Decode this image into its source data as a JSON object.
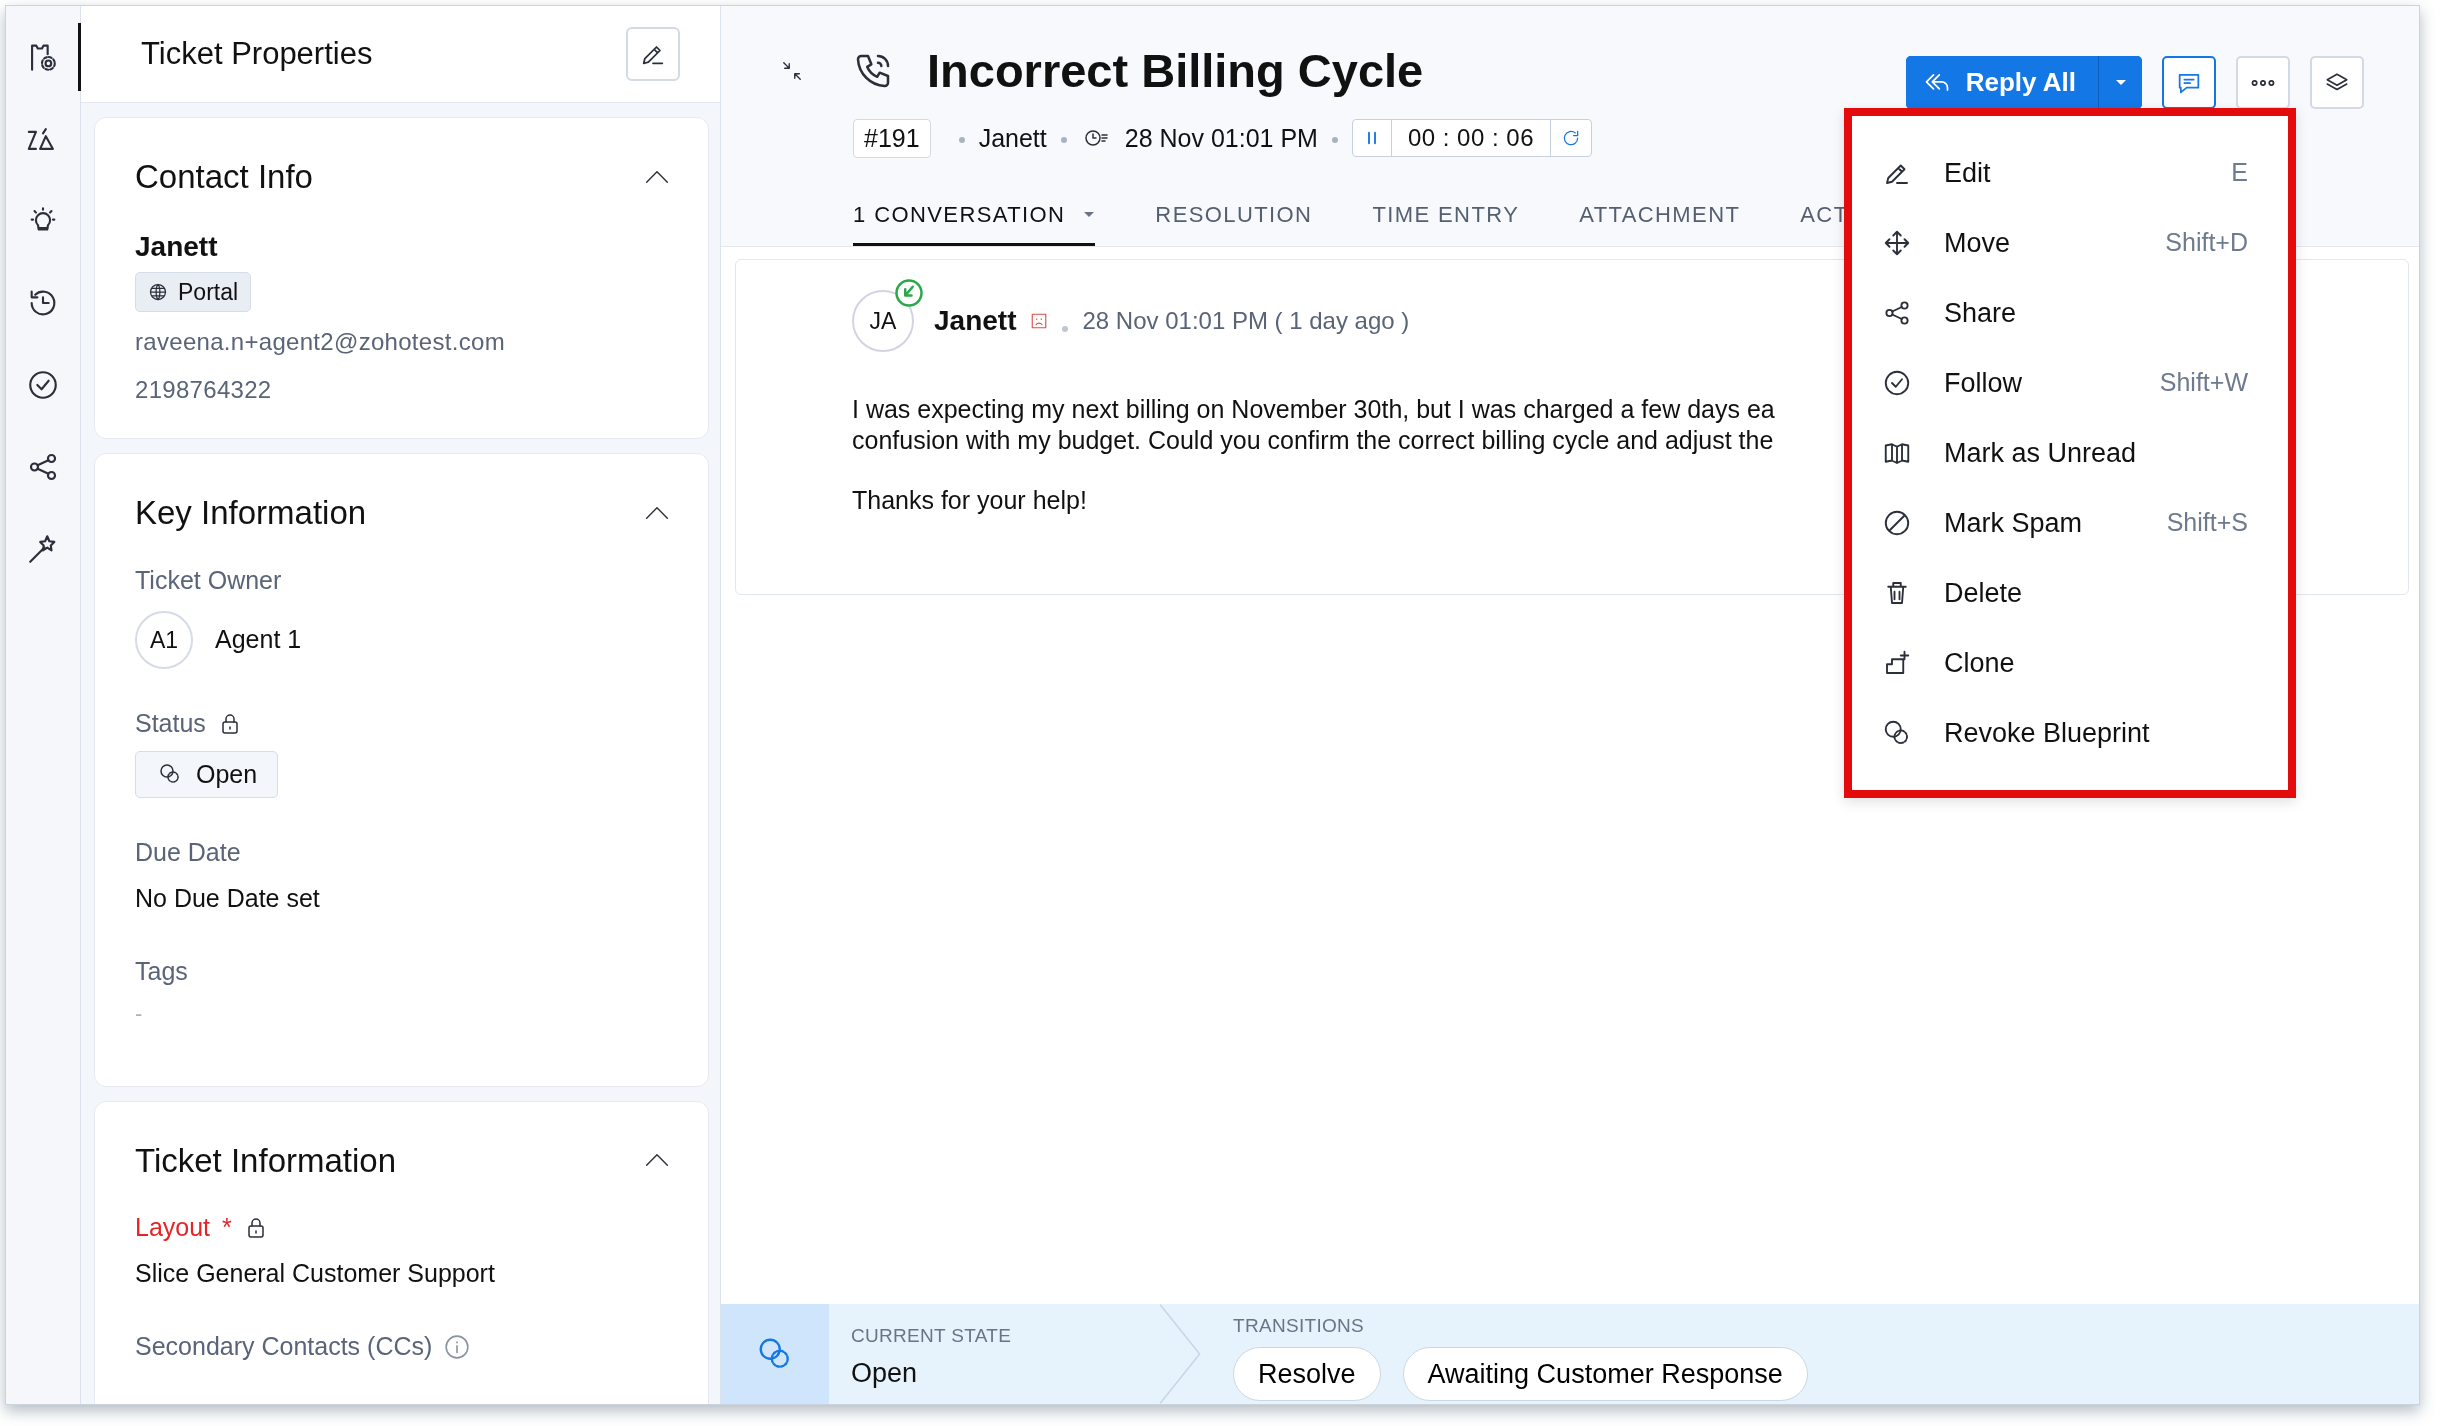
{
  "rail": {
    "items": [
      {
        "selected": true
      },
      {
        "selected": false
      },
      {
        "selected": false
      },
      {
        "selected": false
      },
      {
        "selected": false
      },
      {
        "selected": false
      },
      {
        "selected": false
      }
    ]
  },
  "properties_panel": {
    "title": "Ticket Properties"
  },
  "contact_info": {
    "title": "Contact Info",
    "expanded": true,
    "name": "Janett",
    "channel": "Portal",
    "email": "raveena.n+agent2@zohotest.com",
    "phone": "2198764322"
  },
  "key_information": {
    "title": "Key Information",
    "expanded": true,
    "fields": [
      {
        "kind": "owner",
        "label": "Ticket Owner",
        "initials": "A1",
        "value": "Agent 1"
      },
      {
        "kind": "status",
        "label": "Status",
        "locked": true,
        "value": "Open"
      },
      {
        "kind": "text",
        "label": "Due Date",
        "value": "No Due Date set"
      },
      {
        "kind": "empty",
        "label": "Tags",
        "value": "-"
      }
    ]
  },
  "ticket_information": {
    "title": "Ticket Information",
    "expanded": true,
    "fields": [
      {
        "kind": "text",
        "label": "Layout",
        "required": true,
        "required_mark": "*",
        "locked": true,
        "value": "Slice General Customer Support"
      },
      {
        "kind": "info",
        "label": "Secondary Contacts (CCs)"
      }
    ]
  },
  "ticket": {
    "title": "Incorrect Billing Cycle",
    "number": "#191",
    "contact": "Janett",
    "created": "28 Nov 01:01 PM",
    "timer": {
      "running": true,
      "value": "00 : 00 : 06"
    }
  },
  "reply_button": {
    "label": "Reply All"
  },
  "tabs": [
    {
      "label": "1 CONVERSATION",
      "selected": true,
      "dropdown": true
    },
    {
      "label": "RESOLUTION",
      "selected": false
    },
    {
      "label": "TIME ENTRY",
      "selected": false
    },
    {
      "label": "ATTACHMENT",
      "selected": false
    },
    {
      "label": "ACT",
      "selected": false
    }
  ],
  "thread": {
    "initials": "JA",
    "author": "Janett",
    "time": "28 Nov 01:01 PM ( 1 day ago )",
    "body_lines": [
      "I was expecting my next billing on November 30th, but I was charged a few days ea",
      "confusion with my budget. Could you confirm the correct billing cycle and adjust the"
    ],
    "closing": "Thanks for your help!"
  },
  "more_menu": {
    "open": true,
    "items": [
      {
        "label": "Edit",
        "shortcut": "E"
      },
      {
        "label": "Move",
        "shortcut": "Shift+D"
      },
      {
        "label": "Share"
      },
      {
        "label": "Follow",
        "shortcut": "Shift+W"
      },
      {
        "label": "Mark as Unread"
      },
      {
        "label": "Mark Spam",
        "shortcut": "Shift+S"
      },
      {
        "label": "Delete"
      },
      {
        "label": "Clone"
      },
      {
        "label": "Revoke Blueprint"
      }
    ]
  },
  "blueprint_bar": {
    "current_state_label": "CURRENT STATE",
    "current_state": "Open",
    "transitions_label": "TRANSITIONS",
    "transitions": [
      "Resolve",
      "Awaiting Customer Response"
    ]
  }
}
